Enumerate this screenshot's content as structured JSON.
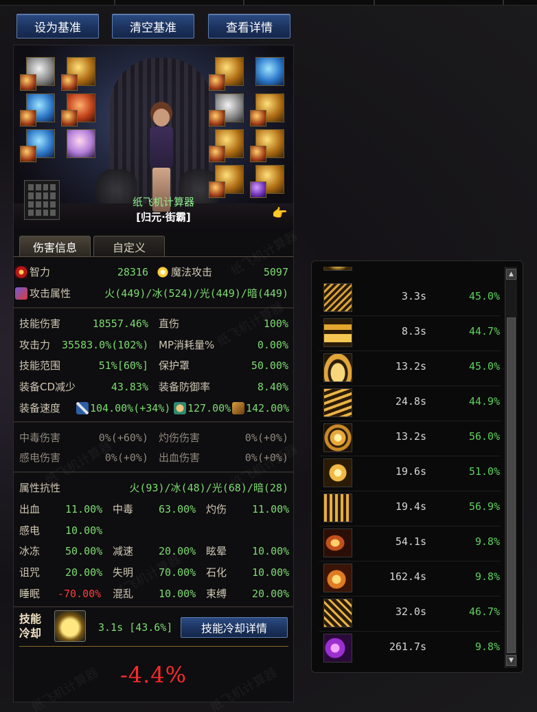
{
  "toolbar": {
    "set_baseline": "设为基准",
    "clear_baseline": "清空基准",
    "view_details": "查看详情"
  },
  "character": {
    "name": "纸飞机计算器",
    "title": "[归元·街霸]"
  },
  "tabs": {
    "damage_info": "伤害信息",
    "custom": "自定义"
  },
  "stats": {
    "intelligence_label": "智力",
    "intelligence_value": "28316",
    "magic_attack_label": "魔法攻击",
    "magic_attack_value": "5097",
    "attack_element_label": "攻击属性",
    "attack_element_value": "火(449)/冰(524)/光(449)/暗(449)",
    "skill_damage_label": "技能伤害",
    "skill_damage_value": "18557.46%",
    "direct_hit_label": "直伤",
    "direct_hit_value": "100%",
    "attack_power_label": "攻击力",
    "attack_power_value": "35583.0%(102%)",
    "mp_cost_label": "MP消耗量%",
    "mp_cost_value": "0.00%",
    "skill_range_label": "技能范围",
    "skill_range_value": "51%[60%]",
    "shield_label": "保护罩",
    "shield_value": "50.00%",
    "equip_cd_label": "装备CD减少",
    "equip_cd_value": "43.83%",
    "equip_def_label": "装备防御率",
    "equip_def_value": "8.40%",
    "equip_speed_label": "装备速度",
    "speed_attack_value": "104.00%(+34%)",
    "speed_cast_value": "127.00%",
    "speed_move_value": "142.00%"
  },
  "dot": {
    "poison_label": "中毒伤害",
    "poison_value": "0%(+60%)",
    "burn_label": "灼伤伤害",
    "burn_value": "0%(+0%)",
    "shock_label": "感电伤害",
    "shock_value": "0%(+0%)",
    "bleed_label": "出血伤害",
    "bleed_value": "0%(+0%)"
  },
  "resist": {
    "title_label": "属性抗性",
    "title_value": "火(93)/冰(48)/光(68)/暗(28)",
    "rows": [
      [
        {
          "label": "出血",
          "value": "11.00%"
        },
        {
          "label": "中毒",
          "value": "63.00%"
        },
        {
          "label": "灼伤",
          "value": "11.00%"
        }
      ],
      [
        {
          "label": "感电",
          "value": "10.00%"
        }
      ],
      [
        {
          "label": "冰冻",
          "value": "50.00%"
        },
        {
          "label": "减速",
          "value": "20.00%"
        },
        {
          "label": "眩晕",
          "value": "10.00%"
        }
      ],
      [
        {
          "label": "诅咒",
          "value": "20.00%"
        },
        {
          "label": "失明",
          "value": "70.00%"
        },
        {
          "label": "石化",
          "value": "10.00%"
        }
      ],
      [
        {
          "label": "睡眠",
          "value": "-70.00%"
        },
        {
          "label": "混乱",
          "value": "10.00%"
        },
        {
          "label": "束缚",
          "value": "20.00%"
        }
      ]
    ]
  },
  "cooldown": {
    "label_line1": "技能",
    "label_line2": "冷却",
    "value": "3.1s [43.6%]",
    "detail_button": "技能冷却详情",
    "delta": "-4.4%"
  },
  "skill_list": [
    {
      "cd": "3.3s",
      "pct": "45.0%"
    },
    {
      "cd": "8.3s",
      "pct": "44.7%"
    },
    {
      "cd": "13.2s",
      "pct": "45.0%"
    },
    {
      "cd": "24.8s",
      "pct": "44.9%"
    },
    {
      "cd": "13.2s",
      "pct": "56.0%"
    },
    {
      "cd": "19.6s",
      "pct": "51.0%"
    },
    {
      "cd": "19.4s",
      "pct": "56.9%"
    },
    {
      "cd": "54.1s",
      "pct": "9.8%"
    },
    {
      "cd": "162.4s",
      "pct": "9.8%"
    },
    {
      "cd": "32.0s",
      "pct": "46.7%"
    },
    {
      "cd": "261.7s",
      "pct": "9.8%"
    }
  ],
  "watermark": "纸飞机计算器",
  "colors": {
    "positive": "#7ddc72",
    "negative": "#ff3b3b",
    "button_blue": "#1c335f",
    "gold": "#8a6a2a"
  }
}
